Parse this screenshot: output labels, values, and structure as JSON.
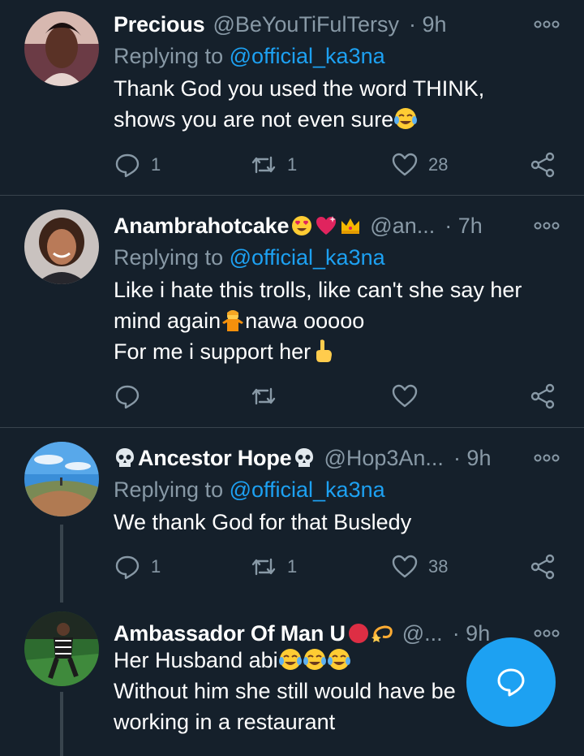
{
  "colors": {
    "background": "#15202b",
    "accent": "#1da1f2",
    "muted": "#8899a6",
    "divider": "#38444d"
  },
  "tweets": [
    {
      "name": "Precious",
      "handle": "@BeYouTiFulTersy",
      "time": "· 9h",
      "replying_prefix": "Replying to ",
      "replying_to": "@official_ka3na",
      "lines": [
        "Thank God you used the word THINK,",
        "shows you are not even sure"
      ],
      "replies": "1",
      "retweets": "1",
      "likes": "28"
    },
    {
      "name": "Anambrahotcake",
      "handle": "@an...",
      "time": "· 7h",
      "replying_prefix": "Replying to ",
      "replying_to": "@official_ka3na",
      "lines": [
        "Like i hate this trolls, like can't she say her",
        "mind again",
        "nawa ooooo",
        "For me i support her"
      ],
      "replies": "",
      "retweets": "",
      "likes": ""
    },
    {
      "name": "Ancestor Hope",
      "handle": "@Hop3An...",
      "time": "· 9h",
      "replying_prefix": "Replying to ",
      "replying_to": "@official_ka3na",
      "lines": [
        "We thank God for that Busledy"
      ],
      "replies": "1",
      "retweets": "1",
      "likes": "38"
    },
    {
      "name": "Ambassador Of Man U",
      "handle": "@...",
      "time": "· 9h",
      "lines": [
        "Her Husband abi",
        "Without him she still would have be",
        "working in a restaurant"
      ]
    }
  ],
  "icons": {
    "more": "more-horizontal-icon",
    "reply": "reply-bubble-icon",
    "retweet": "retweet-icon",
    "like": "heart-icon",
    "share": "share-icon",
    "compose": "compose-reply-icon"
  }
}
